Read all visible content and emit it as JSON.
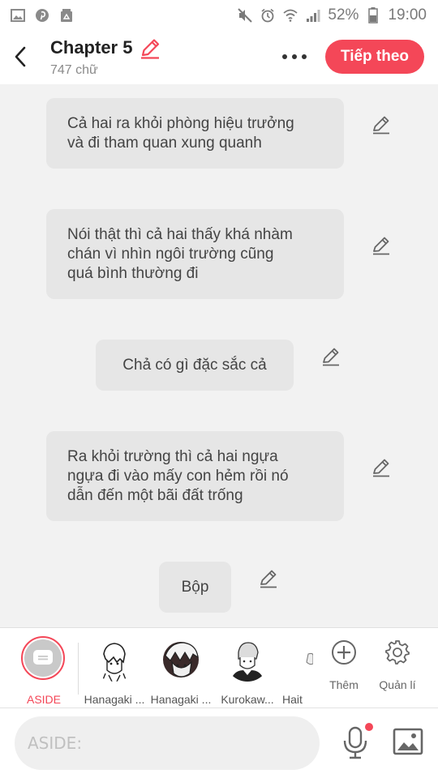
{
  "status_bar": {
    "battery": "52%",
    "time": "19:00",
    "left_icons": [
      "image-icon",
      "pinterest-icon",
      "recycle-icon"
    ],
    "right_icons": [
      "mute-icon",
      "alarm-icon",
      "wifi-icon",
      "signal-icon",
      "battery-icon"
    ]
  },
  "header": {
    "title": "Chapter 5",
    "word_count": "747 chữ",
    "next_label": "Tiếp theo"
  },
  "messages": [
    {
      "text": "Cả hai ra khỏi phòng hiệu trưởng\nvà đi tham quan xung quanh"
    },
    {
      "text": "Nói thật thì cả hai thấy khá nhàm\nchán vì nhìn ngôi trường cũng\nquá bình thường đi"
    },
    {
      "text": "Chả có gì đặc sắc cả"
    },
    {
      "text": "Ra khỏi trường thì cả hai ngựa\nngựa đi vào mấy con hẻm rồi nó\ndẫn đến một bãi đất trống"
    },
    {
      "text": "Bộp"
    }
  ],
  "characters": {
    "aside_label": "ASIDE",
    "items": [
      {
        "label": "Hanagaki ..."
      },
      {
        "label": "Hanagaki ..."
      },
      {
        "label": "Kurokaw..."
      },
      {
        "label": "Hait"
      }
    ],
    "add_label": "Thêm",
    "manage_label": "Quản lí"
  },
  "input": {
    "placeholder": "ASIDE:"
  },
  "colors": {
    "accent": "#f44758",
    "bubble": "#e6e6e6",
    "background": "#f2f2f2"
  }
}
